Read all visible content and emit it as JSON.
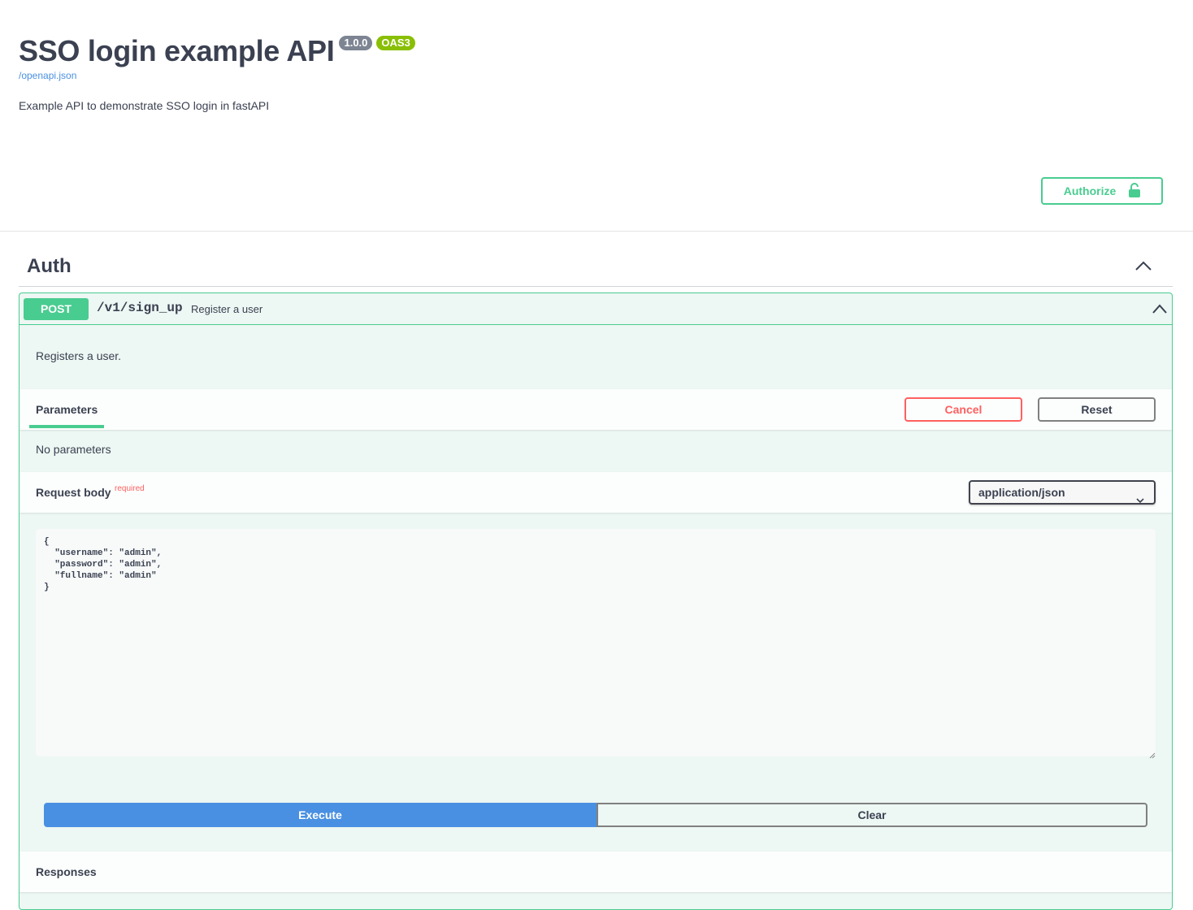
{
  "info": {
    "title": "SSO login example API",
    "version": "1.0.0",
    "oas": "OAS3",
    "spec_link": "/openapi.json",
    "description": "Example API to demonstrate SSO login in fastAPI"
  },
  "authorize": {
    "label": "Authorize",
    "icon": "unlock-icon"
  },
  "tag": {
    "name": "Auth",
    "expanded": true
  },
  "operation": {
    "method": "POST",
    "path": "/v1/sign_up",
    "summary": "Register a user",
    "description": "Registers a user.",
    "parameters_tab": "Parameters",
    "cancel_label": "Cancel",
    "reset_label": "Reset",
    "no_parameters": "No parameters",
    "request_body_label": "Request body",
    "required_label": "required",
    "content_type": "application/json",
    "request_body": "{\n  \"username\": \"admin\",\n  \"password\": \"admin\",\n  \"fullname\": \"admin\"\n}",
    "execute_label": "Execute",
    "clear_label": "Clear",
    "responses_label": "Responses"
  },
  "colors": {
    "post": "#49cc90",
    "execute": "#4990e2",
    "cancel": "#ff6060",
    "text": "#3b4151"
  }
}
